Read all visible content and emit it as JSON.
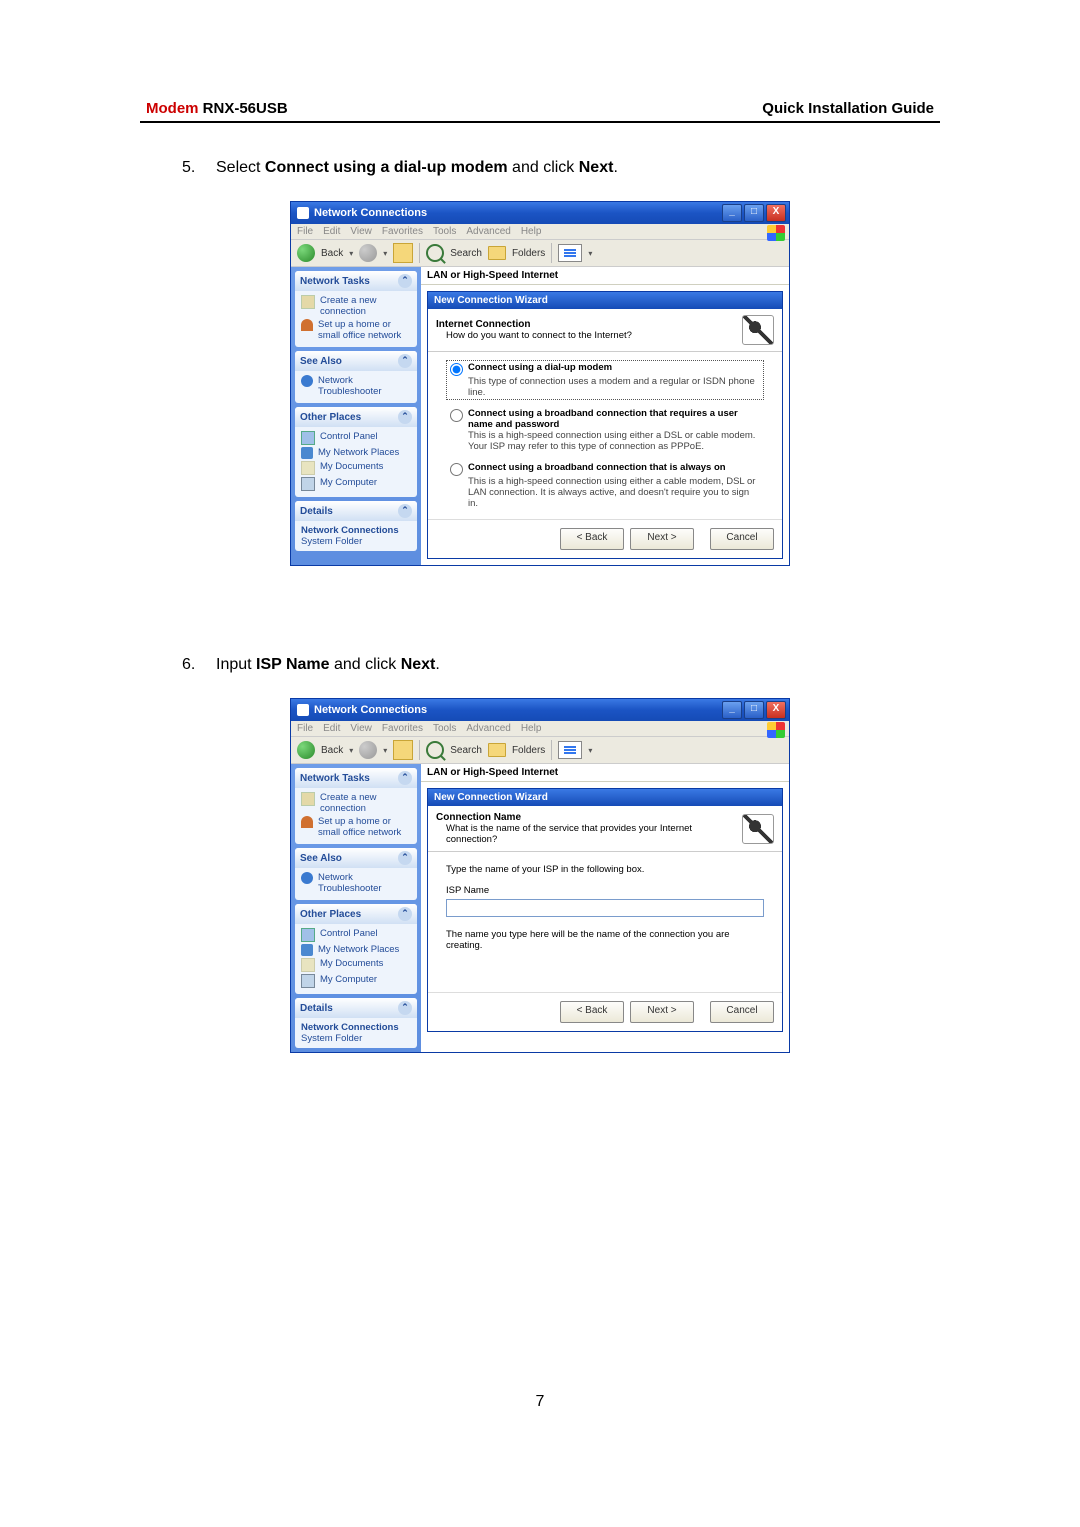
{
  "header": {
    "modem": "Modem",
    "model": "RNX-56USB",
    "right": "Quick Installation Guide"
  },
  "step5": {
    "num": "5.",
    "pre": "Select ",
    "bold": "Connect using a dial-up modem",
    "mid": " and click ",
    "bold2": "Next",
    "post": "."
  },
  "step6": {
    "num": "6.",
    "pre": "Input ",
    "bold": "ISP Name",
    "mid": " and click ",
    "bold2": "Next",
    "post": "."
  },
  "pageNum": "7",
  "xp": {
    "windowTitle": "Network Connections",
    "menu": [
      "File",
      "Edit",
      "View",
      "Favorites",
      "Tools",
      "Advanced",
      "Help"
    ],
    "toolbar": {
      "back": "Back",
      "search": "Search",
      "folders": "Folders"
    },
    "mainHead": "LAN or High-Speed Internet",
    "sidebar": {
      "tasks": {
        "title": "Network Tasks",
        "items": [
          "Create a new connection",
          "Set up a home or small office network"
        ]
      },
      "see": {
        "title": "See Also",
        "items": [
          "Network Troubleshooter"
        ]
      },
      "other": {
        "title": "Other Places",
        "items": [
          "Control Panel",
          "My Network Places",
          "My Documents",
          "My Computer"
        ]
      },
      "details": {
        "title": "Details",
        "l1": "Network Connections",
        "l2": "System Folder"
      }
    },
    "wizTitle": "New Connection Wizard",
    "btnBack": "< Back",
    "btnNext": "Next >",
    "btnCancel": "Cancel"
  },
  "wiz1": {
    "head": "Internet Connection",
    "sub": "How do you want to connect to the Internet?",
    "r1t": "Connect using a dial-up modem",
    "r1d": "This type of connection uses a modem and a regular or ISDN phone line.",
    "r2t": "Connect using a broadband connection that requires a user name and password",
    "r2d": "This is a high-speed connection using either a DSL or cable modem. Your ISP may refer to this type of connection as PPPoE.",
    "r3t": "Connect using a broadband connection that is always on",
    "r3d": "This is a high-speed connection using either a cable modem, DSL or LAN connection. It is always active, and doesn't require you to sign in."
  },
  "wiz2": {
    "head": "Connection Name",
    "sub": "What is the name of the service that provides your Internet connection?",
    "lbl": "Type the name of your ISP in the following box.",
    "fld": "ISP Name",
    "note": "The name you type here will be the name of the connection you are creating."
  }
}
